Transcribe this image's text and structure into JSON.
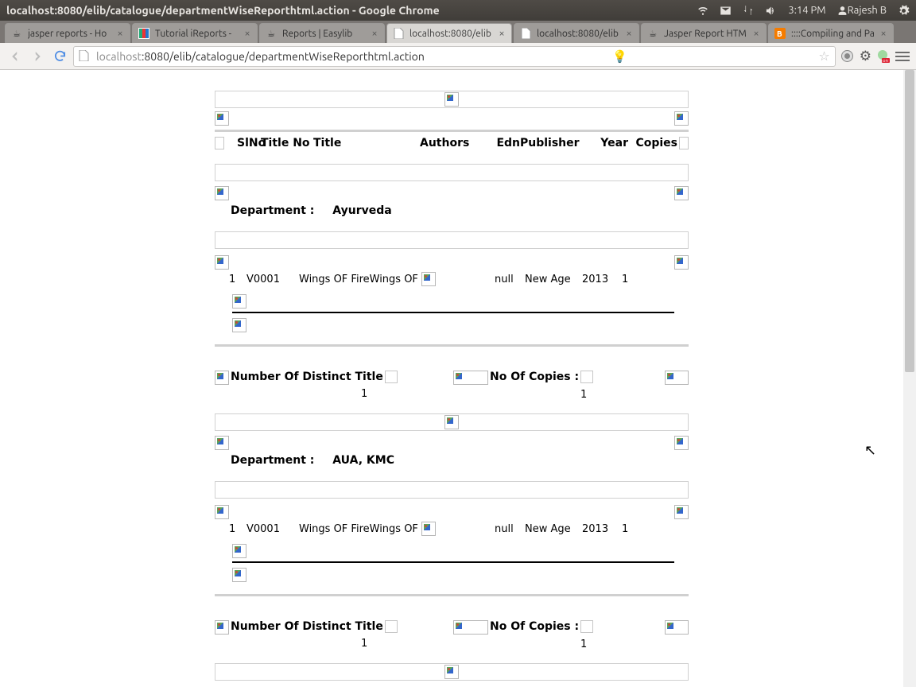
{
  "window": {
    "title": "localhost:8080/elib/catalogue/departmentWiseReporthtml.action - Google Chrome",
    "time": "3:14 PM",
    "user": "Rajesh B"
  },
  "tabs": [
    {
      "label": "jasper reports - Ho",
      "active": false,
      "icon": "java"
    },
    {
      "label": "Tutorial iReports - ",
      "active": false,
      "icon": "ireport"
    },
    {
      "label": "Reports | Easylib",
      "active": false,
      "icon": "java"
    },
    {
      "label": "localhost:8080/elib",
      "active": true,
      "icon": "page"
    },
    {
      "label": "localhost:8080/elib",
      "active": false,
      "icon": "page"
    },
    {
      "label": "Jasper Report HTM",
      "active": false,
      "icon": "java"
    },
    {
      "label": "::::Compiling and Pa",
      "active": false,
      "icon": "blogger"
    }
  ],
  "omnibox": {
    "host": "localhost",
    "path": ":8080/elib/catalogue/departmentWiseReporthtml.action"
  },
  "report": {
    "columns": {
      "slno": "SlNo",
      "titleno": "Title No",
      "title": "Title",
      "authors": "Authors",
      "edn": "Edn",
      "publisher": "Publisher",
      "year": "Year",
      "copies": "Copies"
    },
    "labels": {
      "department": "Department :",
      "distinct": "Number Of Distinct Title",
      "copies": "No Of Copies :"
    },
    "sections": [
      {
        "department": "Ayurveda",
        "rows": [
          {
            "slno": "1",
            "titleno": "V0001",
            "title": "Wings OF FireWings OF",
            "edn": "null",
            "publisher": "New Age",
            "year": "2013",
            "copies": "1"
          }
        ],
        "distinct": "1",
        "copies": "1"
      },
      {
        "department": "AUA, KMC",
        "rows": [
          {
            "slno": "1",
            "titleno": "V0001",
            "title": "Wings OF FireWings OF",
            "edn": "null",
            "publisher": "New Age",
            "year": "2013",
            "copies": "1"
          }
        ],
        "distinct": "1",
        "copies": "1"
      }
    ]
  }
}
